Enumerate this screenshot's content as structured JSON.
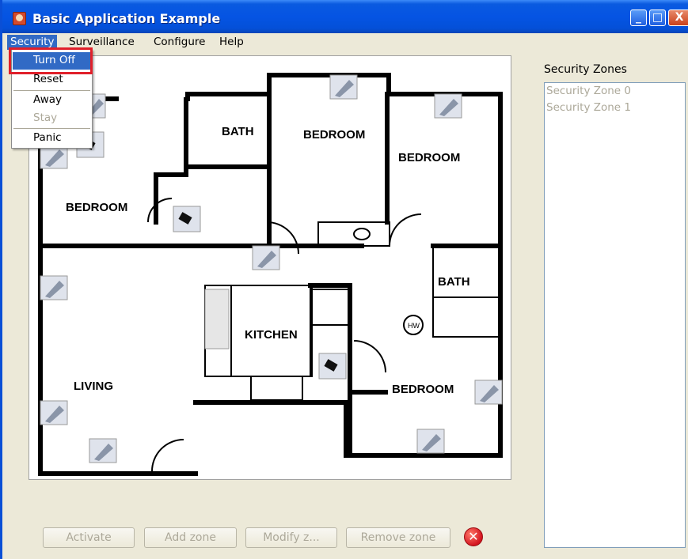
{
  "window": {
    "title": "Basic Application Example",
    "controls": {
      "minimize": "_",
      "maximize": "□",
      "close": "X"
    }
  },
  "menubar": {
    "items": [
      "Security",
      "Surveillance",
      "Configure",
      "Help"
    ],
    "active": "Security"
  },
  "security_menu": {
    "items": [
      {
        "label": "Turn Off",
        "state": "selected"
      },
      {
        "label": "Reset",
        "state": "enabled"
      },
      {
        "label": "Away",
        "state": "enabled"
      },
      {
        "label": "Stay",
        "state": "disabled"
      },
      {
        "label": "Panic",
        "state": "enabled"
      }
    ]
  },
  "floor_plan": {
    "rooms": [
      "BEDROOM",
      "BATH",
      "BEDROOM",
      "BEDROOM",
      "BATH",
      "KITCHEN",
      "LIVING",
      "BEDROOM"
    ],
    "fixtures": [
      "HW"
    ],
    "device_icons": [
      "sensor-icon",
      "camera-icon"
    ]
  },
  "zones_panel": {
    "label": "Security Zones",
    "zones": [
      "Security Zone 0",
      "Security Zone 1"
    ]
  },
  "buttons": {
    "activate": "Activate",
    "add_zone": "Add zone",
    "modify_zone": "Modify z...",
    "remove_zone": "Remove zone",
    "error_icon": "x-circle-icon"
  },
  "colors": {
    "titlebar": "#0554e3",
    "menu_highlight": "#316ac5",
    "annotation_box": "#e0202a",
    "window_bg": "#ece9d8"
  }
}
